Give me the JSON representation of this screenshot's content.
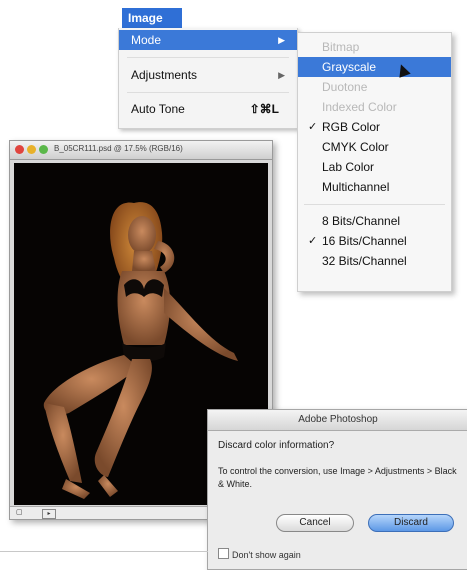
{
  "image_menu": {
    "title": "Image",
    "items": [
      {
        "label": "Mode",
        "arrow": "▶",
        "highlighted": true
      },
      {
        "label": "Adjustments",
        "arrow": "▶"
      },
      {
        "label": "Auto Tone",
        "shortcut": "⇧⌘L"
      }
    ]
  },
  "mode_menu": {
    "items": [
      {
        "label": "Bitmap",
        "disabled": true
      },
      {
        "label": "Grayscale",
        "highlighted": true
      },
      {
        "label": "Duotone",
        "disabled": true
      },
      {
        "label": "Indexed Color",
        "disabled": true
      },
      {
        "label": "RGB Color",
        "checked": true
      },
      {
        "label": "CMYK Color"
      },
      {
        "label": "Lab Color"
      },
      {
        "label": "Multichannel"
      },
      {
        "label": "8 Bits/Channel"
      },
      {
        "label": "16 Bits/Channel",
        "checked": true
      },
      {
        "label": "32 Bits/Channel"
      }
    ],
    "check_glyph": "✓"
  },
  "document": {
    "title": "B_05CR111.psd @ 17.5% (RGB/16)"
  },
  "dialog": {
    "title": "Adobe Photoshop",
    "question": "Discard color information?",
    "message": "To control the conversion, use Image > Adjustments > Black & White.",
    "cancel_label": "Cancel",
    "discard_label": "Discard",
    "dont_show_label": "Don't show again"
  },
  "colors": {
    "menu_highlight": "#3b79d8",
    "canvas_background": "#060403"
  }
}
